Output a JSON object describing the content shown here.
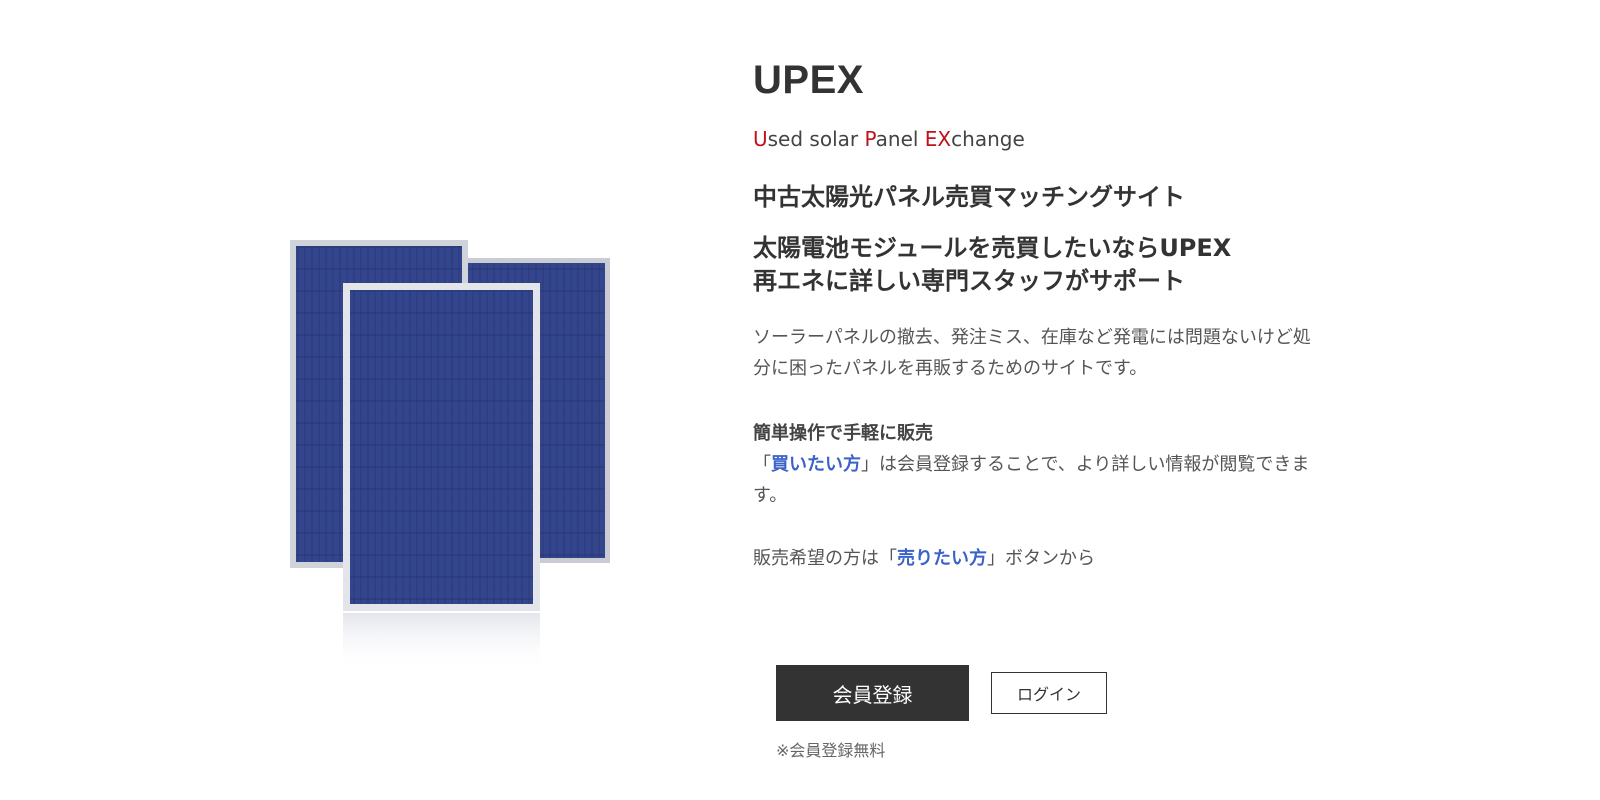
{
  "brand": {
    "title": "UPEX",
    "subtitle_parts": [
      {
        "text": "U",
        "highlight": true
      },
      {
        "text": "sed solar ",
        "highlight": false
      },
      {
        "text": "P",
        "highlight": true
      },
      {
        "text": "anel ",
        "highlight": false
      },
      {
        "text": "EX",
        "highlight": true
      },
      {
        "text": "change",
        "highlight": false
      }
    ],
    "highlight_color": "#c0121b"
  },
  "hero": {
    "tagline": "中古太陽光パネル売買マッチングサイト",
    "catch_line1": "太陽電池モジュールを売買したいならUPEX",
    "catch_line2": "再エネに詳しい専門スタッフがサポート",
    "description": "ソーラーパネルの撤去、発注ミス、在庫など発電には問題ないけど処分に困ったパネルを再販するためのサイトです。"
  },
  "feature": {
    "heading": "簡単操作で手軽に販売",
    "buyer_prefix": "「",
    "buyer_link": "買いたい方",
    "buyer_suffix": "」は会員登録することで、より詳しい情報が閲覧できます。"
  },
  "seller": {
    "prefix": "販売希望の方は「",
    "link": "売りたい方",
    "suffix": "」ボタンから"
  },
  "actions": {
    "register_label": "会員登録",
    "login_label": "ログイン",
    "note": "※会員登録無料"
  },
  "colors": {
    "accent_link": "#3b62c8",
    "button_dark": "#333333",
    "panel_cell": "#2a3a7a"
  },
  "image": {
    "icon": "solar-panel-image"
  }
}
